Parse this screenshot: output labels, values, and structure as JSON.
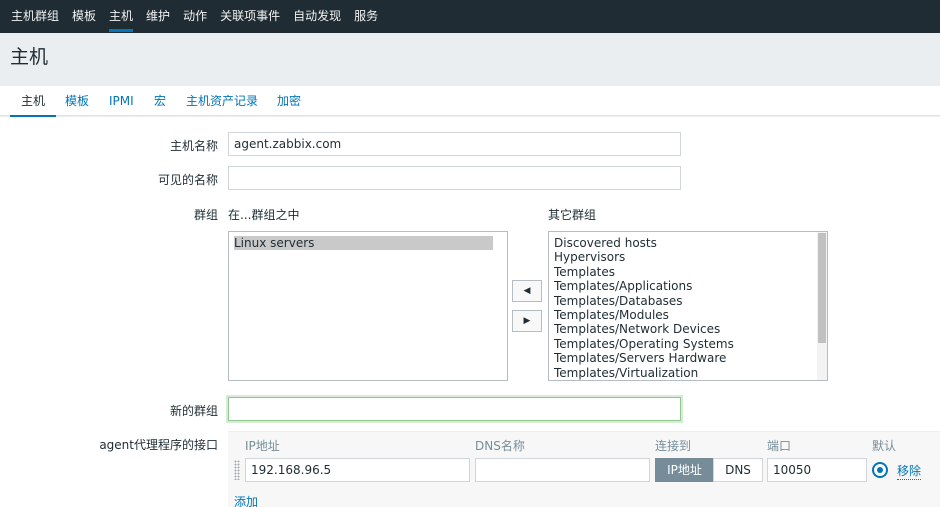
{
  "topnav": {
    "items": [
      {
        "label": "主机群组"
      },
      {
        "label": "模板"
      },
      {
        "label": "主机"
      },
      {
        "label": "维护"
      },
      {
        "label": "动作"
      },
      {
        "label": "关联项事件"
      },
      {
        "label": "自动发现"
      },
      {
        "label": "服务"
      }
    ],
    "active_index": 2
  },
  "page": {
    "title": "主机"
  },
  "tabs": [
    {
      "label": "主机"
    },
    {
      "label": "模板"
    },
    {
      "label": "IPMI"
    },
    {
      "label": "宏"
    },
    {
      "label": "主机资产记录"
    },
    {
      "label": "加密"
    }
  ],
  "form": {
    "host_name": {
      "label": "主机名称",
      "value": "agent.zabbix.com"
    },
    "visible_name": {
      "label": "可见的名称",
      "value": ""
    },
    "groups": {
      "label": "群组",
      "in_groups_label": "在...群组之中",
      "other_groups_label": "其它群组",
      "in_groups": [
        "Linux servers"
      ],
      "other_groups": [
        "Discovered hosts",
        "Hypervisors",
        "Templates",
        "Templates/Applications",
        "Templates/Databases",
        "Templates/Modules",
        "Templates/Network Devices",
        "Templates/Operating Systems",
        "Templates/Servers Hardware",
        "Templates/Virtualization"
      ],
      "move_left_glyph": "◀",
      "move_right_glyph": "▶"
    },
    "new_group": {
      "label": "新的群组",
      "value": ""
    },
    "agent_interfaces": {
      "label": "agent代理程序的接口",
      "columns": {
        "ip": "IP地址",
        "dns": "DNS名称",
        "connect_to": "连接到",
        "port": "端口",
        "default": "默认"
      },
      "row": {
        "ip": "192.168.96.5",
        "dns": "",
        "connect_ip_label": "IP地址",
        "connect_dns_label": "DNS",
        "connect_selected": "IP地址",
        "port": "10050",
        "is_default": true,
        "remove_label": "移除"
      },
      "add_label": "添加"
    }
  },
  "colors": {
    "nav_bg": "#1f2c33",
    "accent": "#0275b8",
    "page_bg": "#ebeef0",
    "selected_option_bg": "#c9c9c9",
    "segment_active_bg": "#768d99",
    "focus_border": "#8fc98f"
  }
}
